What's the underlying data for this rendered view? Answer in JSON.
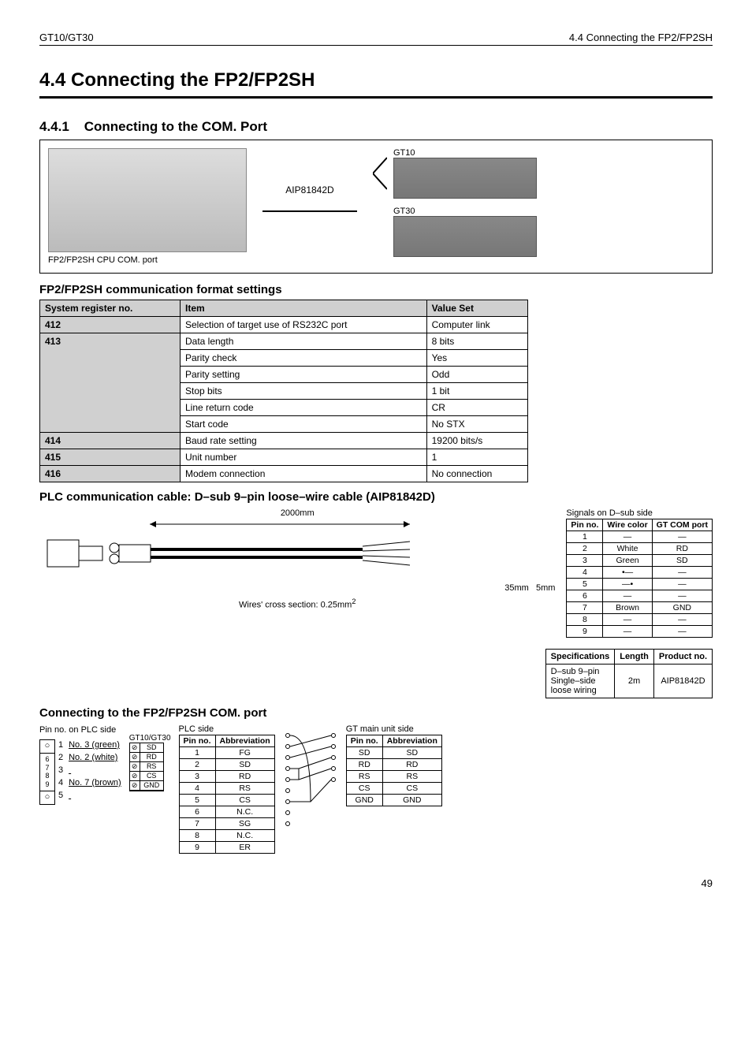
{
  "header": {
    "left": "GT10/GT30",
    "right": "4.4   Connecting the FP2/FP2SH"
  },
  "title": "4.4   Connecting the FP2/FP2SH",
  "sub1": {
    "num": "4.4.1",
    "title": "Connecting to the COM. Port"
  },
  "diagram": {
    "plc_caption": "FP2/FP2SH CPU COM. port",
    "cable": "AIP81842D",
    "gt10": "GT10",
    "gt30": "GT30"
  },
  "settingsHeading": "FP2/FP2SH communication format settings",
  "settingsCols": [
    "System register no.",
    "Item",
    "Value Set"
  ],
  "settings": [
    {
      "reg": "412",
      "rows": [
        [
          "Selection of target use of RS232C port",
          "Computer link"
        ]
      ]
    },
    {
      "reg": "413",
      "rows": [
        [
          "Data length",
          "8 bits"
        ],
        [
          "Parity check",
          "Yes"
        ],
        [
          "Parity setting",
          "Odd"
        ],
        [
          "Stop bits",
          "1 bit"
        ],
        [
          "Line return code",
          "CR"
        ],
        [
          "Start code",
          "No STX"
        ]
      ]
    },
    {
      "reg": "414",
      "rows": [
        [
          "Baud rate setting",
          "19200 bits/s"
        ]
      ]
    },
    {
      "reg": "415",
      "rows": [
        [
          "Unit number",
          "1"
        ]
      ]
    },
    {
      "reg": "416",
      "rows": [
        [
          "Modem connection",
          "No connection"
        ]
      ]
    }
  ],
  "cableHeading": "PLC communication cable: D–sub 9–pin loose–wire cable (AIP81842D)",
  "cableDims": {
    "total": "2000mm",
    "mid": "35mm",
    "end": "5mm",
    "wires": "Wires' cross section: 0.25mm"
  },
  "signalsCaption": "Signals on D–sub side",
  "signalsCols": [
    "Pin no.",
    "Wire color",
    "GT COM port"
  ],
  "signals": [
    [
      "1",
      "—",
      "—"
    ],
    [
      "2",
      "White",
      "RD"
    ],
    [
      "3",
      "Green",
      "SD"
    ],
    [
      "4",
      "•—",
      "—"
    ],
    [
      "5",
      "—•",
      "—"
    ],
    [
      "6",
      "—",
      "—"
    ],
    [
      "7",
      "Brown",
      "GND"
    ],
    [
      "8",
      "—",
      "—"
    ],
    [
      "9",
      "—",
      "—"
    ]
  ],
  "specCols": [
    "Specifications",
    "Length",
    "Product no."
  ],
  "spec": {
    "desc": "D–sub 9–pin\nSingle–side\nloose wiring",
    "len": "2m",
    "pn": "AIP81842D"
  },
  "connHeading": "Connecting to the FP2/FP2SH COM. port",
  "plcSide": {
    "caption": "Pin no. on PLC side",
    "lines": [
      {
        "n": "1",
        "txt": "No. 3 (green)"
      },
      {
        "n": "2",
        "txt": "No. 2 (white)"
      },
      {
        "n": "3",
        "txt": ""
      },
      {
        "n": "4",
        "txt": "No. 7 (brown)"
      },
      {
        "n": "5",
        "txt": ""
      }
    ],
    "shell": [
      "6",
      "7",
      "8",
      "9"
    ]
  },
  "gtTermLabel": "GT10/GT30",
  "gtTerm": [
    "SD",
    "RD",
    "RS",
    "CS",
    "GND"
  ],
  "plcTable": {
    "caption": "PLC side",
    "cols": [
      "Pin no.",
      "Abbreviation"
    ],
    "rows": [
      [
        "1",
        "FG"
      ],
      [
        "2",
        "SD"
      ],
      [
        "3",
        "RD"
      ],
      [
        "4",
        "RS"
      ],
      [
        "5",
        "CS"
      ],
      [
        "6",
        "N.C."
      ],
      [
        "7",
        "SG"
      ],
      [
        "8",
        "N.C."
      ],
      [
        "9",
        "ER"
      ]
    ]
  },
  "gtMain": {
    "caption": "GT main unit side",
    "cols": [
      "Pin no.",
      "Abbreviation"
    ],
    "rows": [
      [
        "SD",
        "SD"
      ],
      [
        "RD",
        "RD"
      ],
      [
        "RS",
        "RS"
      ],
      [
        "CS",
        "CS"
      ],
      [
        "GND",
        "GND"
      ]
    ]
  },
  "pageNum": "49"
}
